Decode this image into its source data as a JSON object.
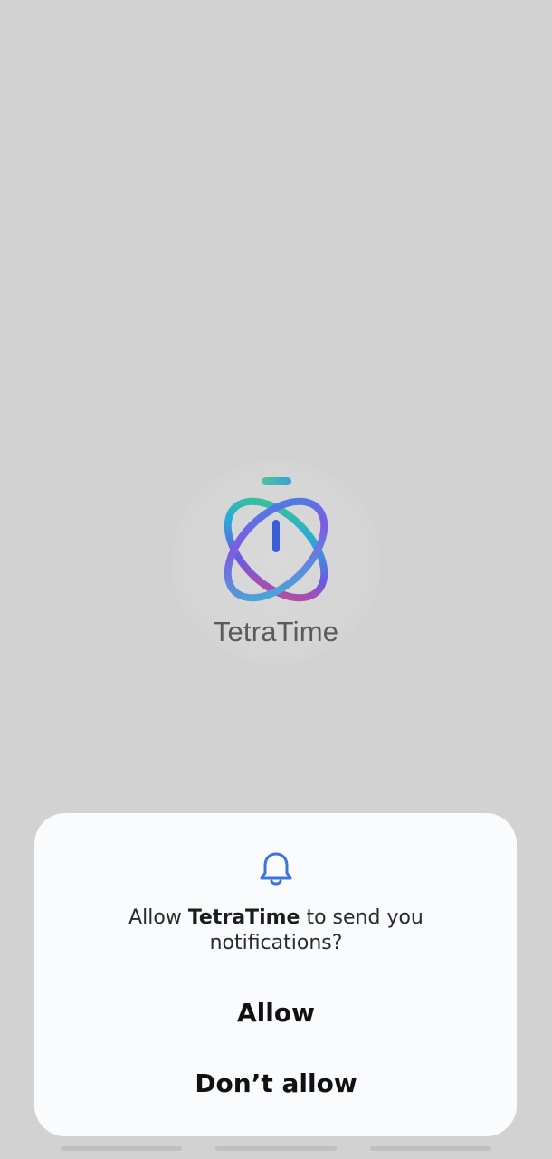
{
  "app": {
    "name": "TetraTime",
    "logo_icon": "tetratime-stopwatch-logo"
  },
  "dialog": {
    "icon": "bell-icon",
    "accent_color": "#3b73e0",
    "message_prefix": "Allow ",
    "message_app": "TetraTime",
    "message_suffix": " to send you notifications?",
    "allow_label": "Allow",
    "deny_label": "Don’t allow"
  }
}
